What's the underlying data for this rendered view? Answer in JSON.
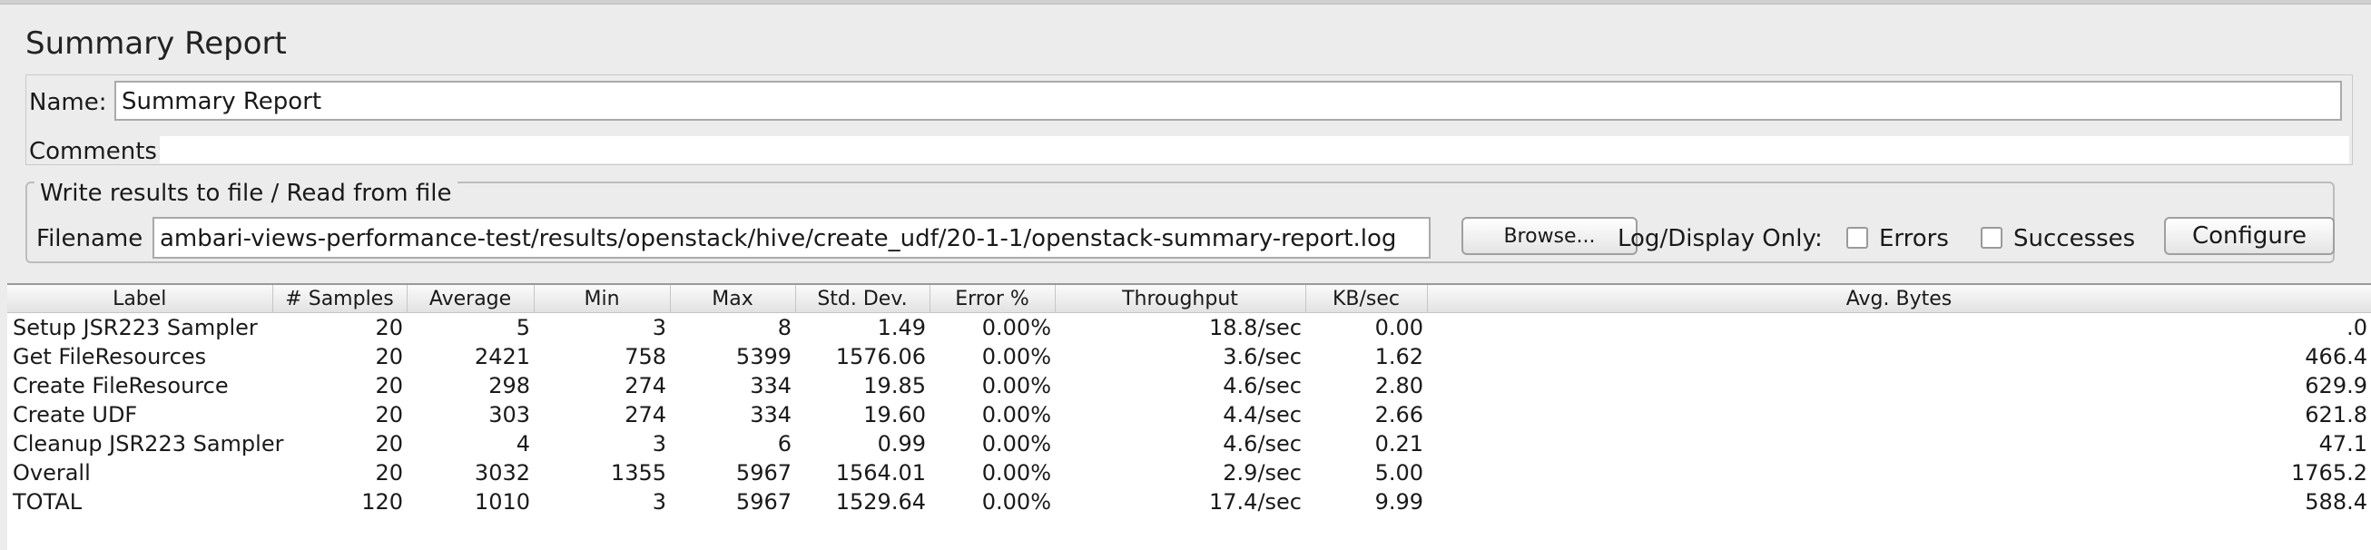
{
  "panel": {
    "title": "Summary Report",
    "name_label": "Name:",
    "name_value": "Summary Report",
    "comments_label": "Comments:",
    "file_group_label": "Write results to file / Read from file",
    "filename_label": "Filename",
    "filename_value": "ambari-views-performance-test/results/openstack/hive/create_udf/20-1-1/openstack-summary-report.log",
    "browse_label": "Browse...",
    "log_display_label": "Log/Display Only:",
    "errors_label": "Errors",
    "successes_label": "Successes",
    "configure_label": "Configure"
  },
  "table": {
    "columns": [
      "Label",
      "# Samples",
      "Average",
      "Min",
      "Max",
      "Std. Dev.",
      "Error %",
      "Throughput",
      "KB/sec",
      "Avg. Bytes"
    ],
    "rows": [
      [
        "Setup JSR223 Sampler",
        "20",
        "5",
        "3",
        "8",
        "1.49",
        "0.00%",
        "18.8/sec",
        "0.00",
        ".0"
      ],
      [
        "Get FileResources",
        "20",
        "2421",
        "758",
        "5399",
        "1576.06",
        "0.00%",
        "3.6/sec",
        "1.62",
        "466.4"
      ],
      [
        "Create FileResource",
        "20",
        "298",
        "274",
        "334",
        "19.85",
        "0.00%",
        "4.6/sec",
        "2.80",
        "629.9"
      ],
      [
        "Create UDF",
        "20",
        "303",
        "274",
        "334",
        "19.60",
        "0.00%",
        "4.4/sec",
        "2.66",
        "621.8"
      ],
      [
        "Cleanup JSR223 Sampler",
        "20",
        "4",
        "3",
        "6",
        "0.99",
        "0.00%",
        "4.6/sec",
        "0.21",
        "47.1"
      ],
      [
        "Overall",
        "20",
        "3032",
        "1355",
        "5967",
        "1564.01",
        "0.00%",
        "2.9/sec",
        "5.00",
        "1765.2"
      ],
      [
        "TOTAL",
        "120",
        "1010",
        "3",
        "5967",
        "1529.64",
        "0.00%",
        "17.4/sec",
        "9.99",
        "588.4"
      ]
    ]
  }
}
